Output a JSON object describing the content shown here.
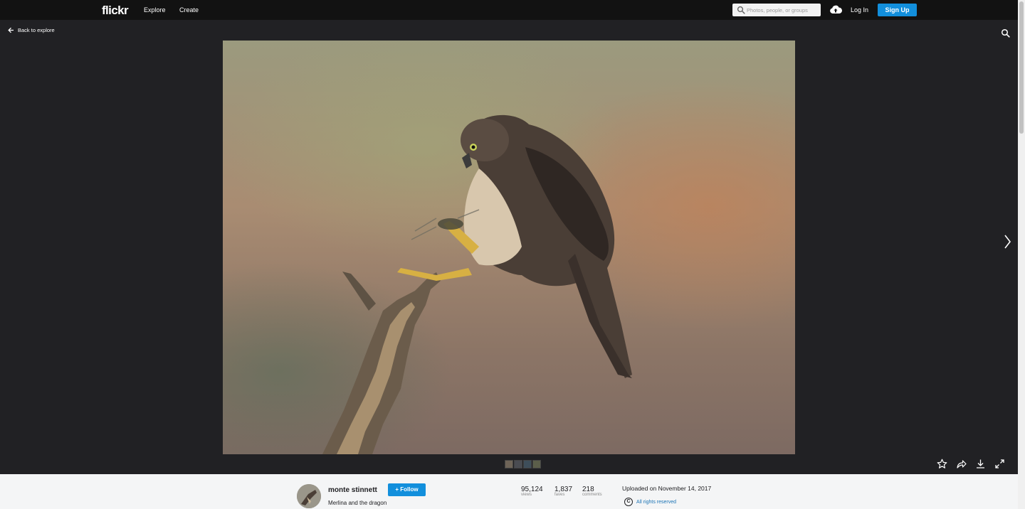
{
  "nav": {
    "logo": "flickr",
    "explore": "Explore",
    "create": "Create",
    "search_placeholder": "Photos, people, or groups",
    "login": "Log In",
    "signup": "Sign Up"
  },
  "viewer": {
    "back_label": "Back to explore",
    "thumbnail_count": 4
  },
  "info": {
    "owner": "monte stinnett",
    "follow": "Follow",
    "title": "Merlina and the dragon",
    "views": "95,124",
    "views_label": "views",
    "faves": "1,837",
    "faves_label": "faves",
    "comments": "218",
    "comments_label": "comments",
    "uploaded": "Uploaded on November 14, 2017",
    "rights": "All rights reserved"
  },
  "colors": {
    "accent": "#128fdc",
    "background": "#212124",
    "topbar": "#121212",
    "infobar": "#f4f5f6"
  },
  "icons": [
    "search-icon",
    "upload-icon",
    "back-arrow-icon",
    "next-arrow-icon",
    "star-icon",
    "share-icon",
    "download-icon",
    "fullscreen-icon",
    "copyright-icon"
  ]
}
